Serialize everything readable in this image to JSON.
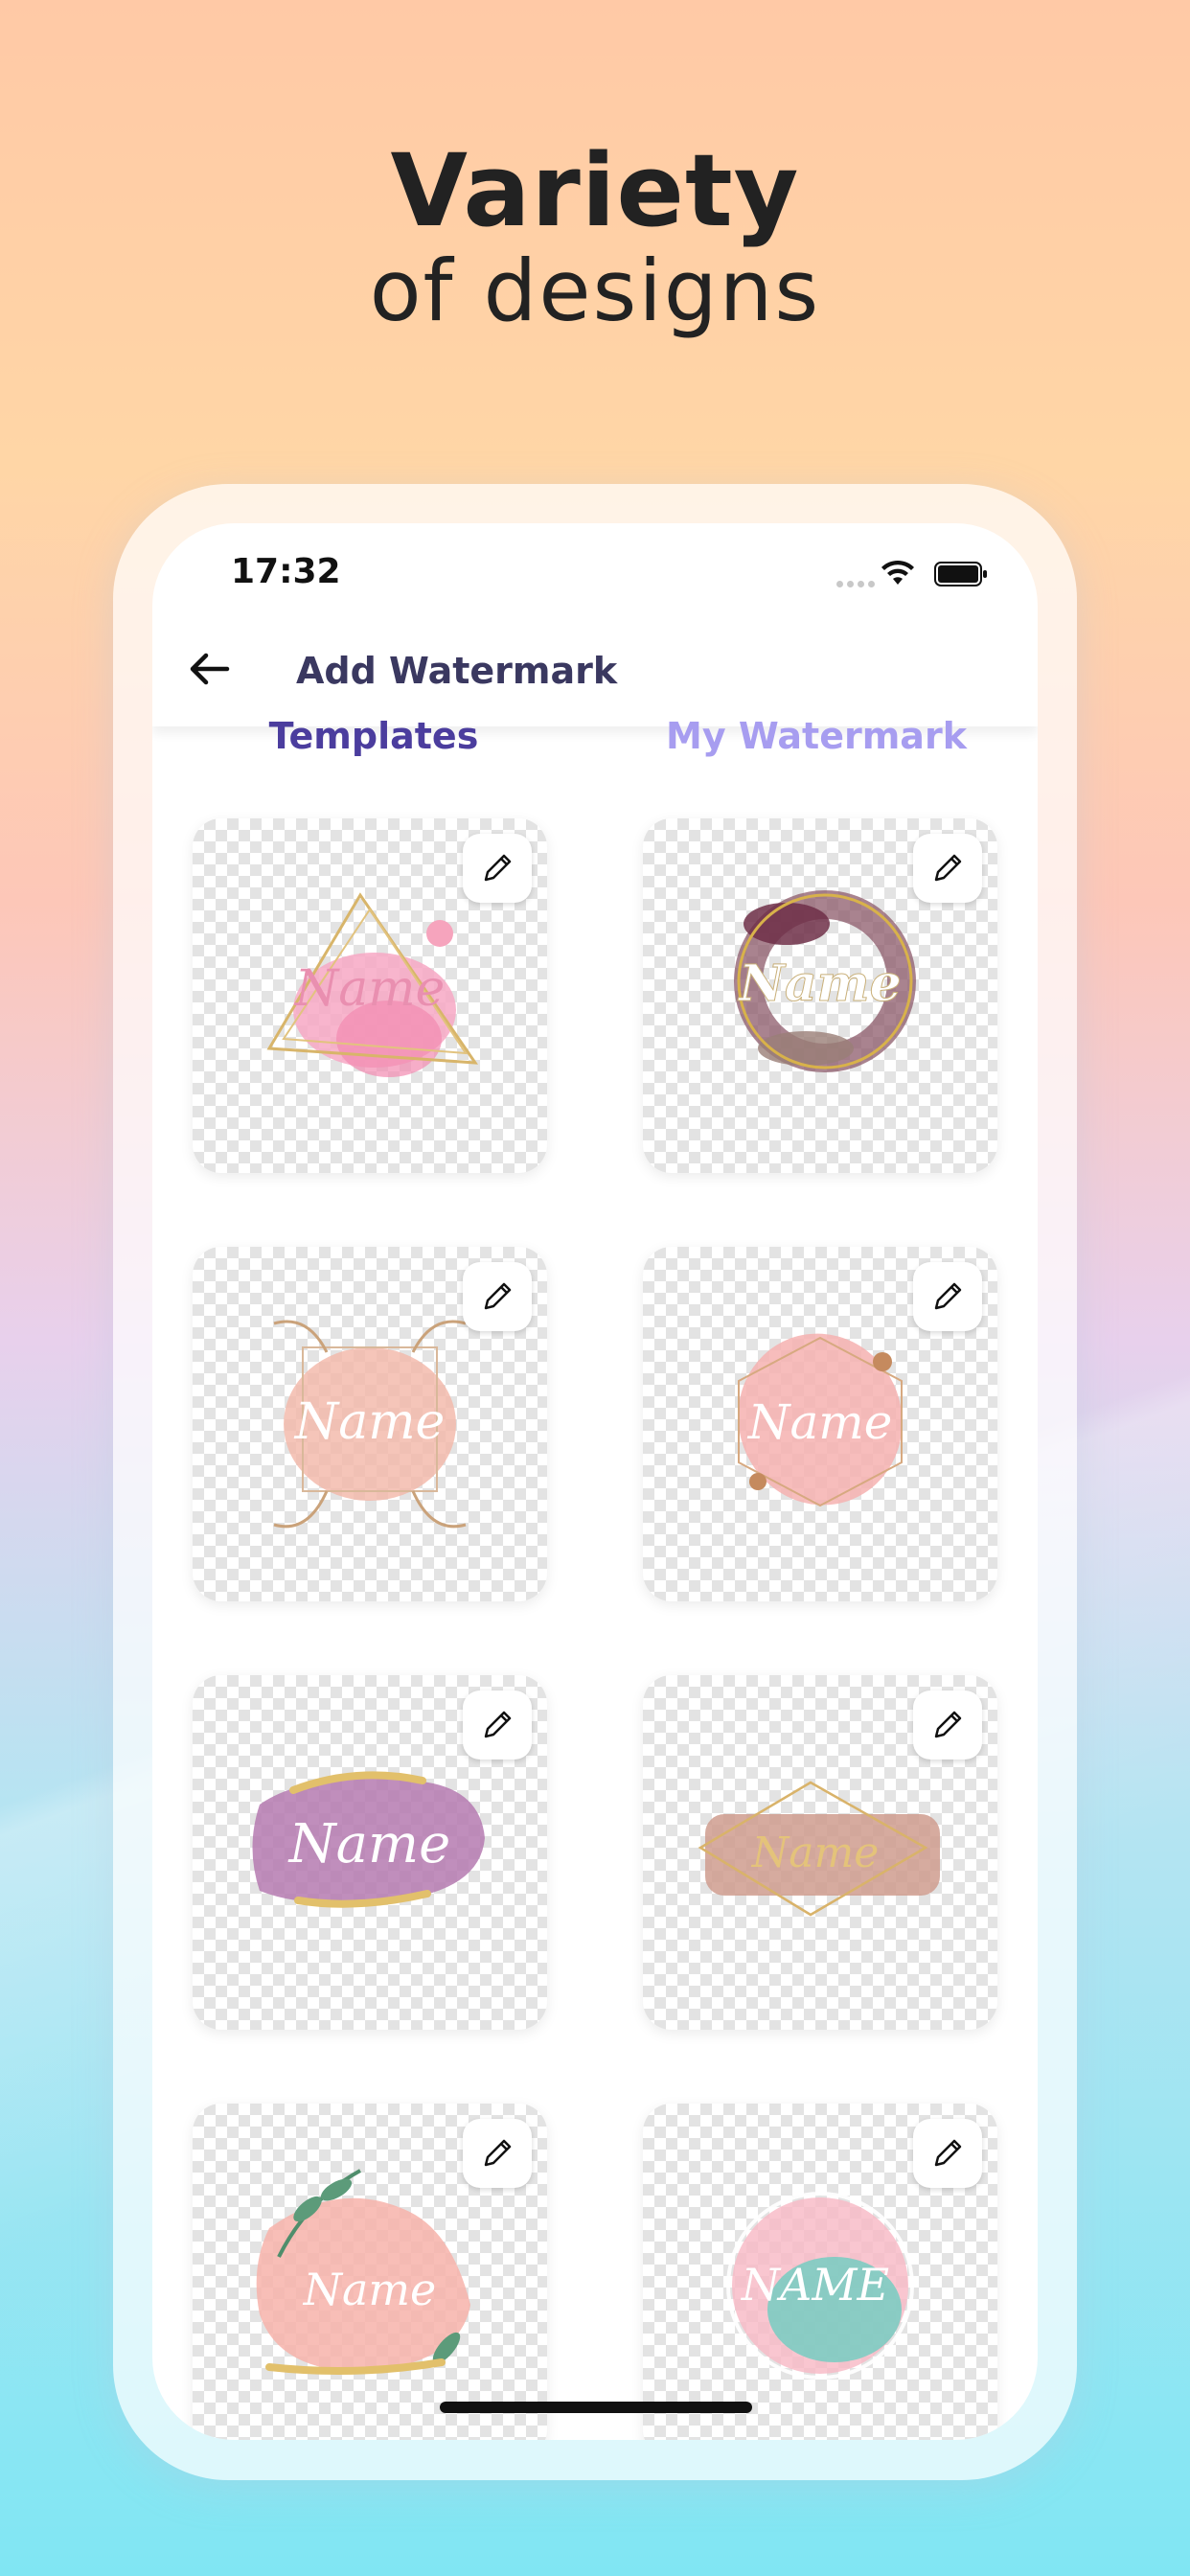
{
  "headline": {
    "line1": "Variety",
    "line2": "of designs"
  },
  "status_bar": {
    "time": "17:32"
  },
  "nav": {
    "title": "Add Watermark",
    "back_icon": "arrow-left-icon"
  },
  "tabs": [
    {
      "label": "Templates",
      "active": true
    },
    {
      "label": "My Watermark",
      "active": false
    }
  ],
  "templates": [
    {
      "name_text": "Name",
      "style": "triangle-gold-pink"
    },
    {
      "name_text": "Name",
      "style": "brown-brush-gold-ring"
    },
    {
      "name_text": "Name",
      "style": "floral-frame-peach"
    },
    {
      "name_text": "Name",
      "style": "hexagon-pink-brush"
    },
    {
      "name_text": "Name",
      "style": "purple-brush-gold"
    },
    {
      "name_text": "Name",
      "style": "diamond-rose-brush"
    },
    {
      "name_text": "Name",
      "style": "leaves-pink-brush"
    },
    {
      "name_text": "NAME",
      "style": "teal-pink-circle"
    }
  ],
  "colors": {
    "tab_active": "#4b3d9e",
    "tab_inactive": "#a79df0",
    "nav_title": "#3a3860"
  }
}
